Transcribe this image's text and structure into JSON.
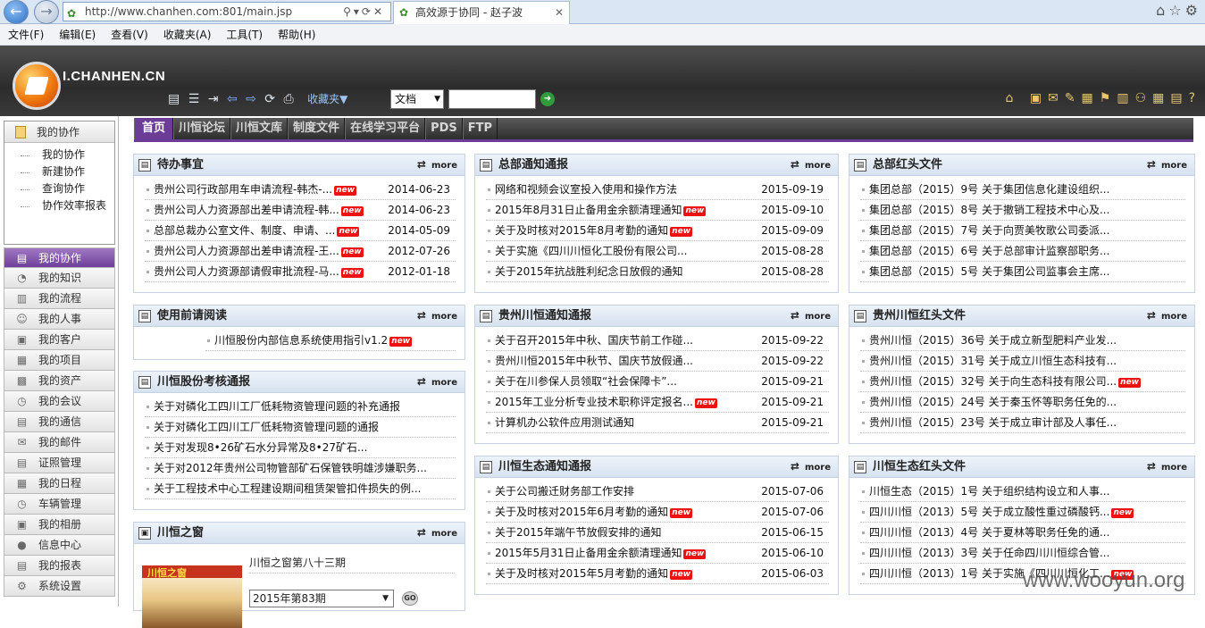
{
  "browser": {
    "url": "http://www.chanhen.com:801/main.jsp",
    "tab_title": "高效源于协同 - 赵子波"
  },
  "menubar": [
    "文件(F)",
    "编辑(E)",
    "查看(V)",
    "收藏夹(A)",
    "工具(T)",
    "帮助(H)"
  ],
  "header": {
    "brand": "I.CHANHEN.CN",
    "favorites_label": "收藏夹▼",
    "doc_type": "文档"
  },
  "sidebar": {
    "box_title": "我的协作",
    "box_items": [
      "我的协作",
      "新建协作",
      "查询协作",
      "协作效率报表"
    ],
    "menu": [
      {
        "label": "我的协作",
        "icon": "collab-icon",
        "active": true
      },
      {
        "label": "我的知识",
        "icon": "knowledge-icon"
      },
      {
        "label": "我的流程",
        "icon": "flow-icon"
      },
      {
        "label": "我的人事",
        "icon": "person-icon"
      },
      {
        "label": "我的客户",
        "icon": "customer-icon"
      },
      {
        "label": "我的项目",
        "icon": "project-icon"
      },
      {
        "label": "我的资产",
        "icon": "asset-icon"
      },
      {
        "label": "我的会议",
        "icon": "meeting-icon"
      },
      {
        "label": "我的通信",
        "icon": "comm-icon"
      },
      {
        "label": "我的邮件",
        "icon": "mail-icon"
      },
      {
        "label": "证照管理",
        "icon": "license-icon"
      },
      {
        "label": "我的日程",
        "icon": "calendar-icon"
      },
      {
        "label": "车辆管理",
        "icon": "car-icon"
      },
      {
        "label": "我的相册",
        "icon": "album-icon"
      },
      {
        "label": "信息中心",
        "icon": "info-icon"
      },
      {
        "label": "我的报表",
        "icon": "report-icon"
      },
      {
        "label": "系统设置",
        "icon": "settings-icon"
      }
    ]
  },
  "tabs": [
    "首页",
    "川恒论坛",
    "川恒文库",
    "制度文件",
    "在线学习平台",
    "PDS",
    "FTP"
  ],
  "more_label": "more",
  "new_label": "new",
  "panels": {
    "todo": {
      "title": "待办事宜",
      "rows": [
        {
          "text": "贵州公司行政部用车申请流程-韩杰-...",
          "new": true,
          "date": "2014-06-23"
        },
        {
          "text": "贵州公司人力资源部出差申请流程-韩...",
          "new": true,
          "date": "2014-06-23"
        },
        {
          "text": "总部总裁办公室文件、制度、申请、...",
          "new": true,
          "date": "2014-05-09"
        },
        {
          "text": "贵州公司人力资源部出差申请流程-王...",
          "new": true,
          "date": "2012-07-26"
        },
        {
          "text": "贵州公司人力资源部请假审批流程-马...",
          "new": true,
          "date": "2012-01-18"
        }
      ]
    },
    "read_before": {
      "title": "使用前请阅读",
      "rows": [
        {
          "text": "川恒股份内部信息系统使用指引v1.2",
          "new": true
        }
      ]
    },
    "audit": {
      "title": "川恒股份考核通报",
      "rows": [
        {
          "text": "关于对磷化工四川工厂低耗物资管理问题的补充通报"
        },
        {
          "text": "关于对磷化工四川工厂低耗物资管理问题的通报"
        },
        {
          "text": "关于对发现8•26矿石水分异常及8•27矿石..."
        },
        {
          "text": "关于对2012年贵州公司物管部矿石保管铁明雄涉嫌职务..."
        },
        {
          "text": "关于工程技术中心工程建设期间租赁架管扣件损失的例..."
        }
      ]
    },
    "window": {
      "title": "川恒之窗",
      "magazine_label": "川恒之窗",
      "item": "川恒之窗第八十三期",
      "issue": "2015年第83期",
      "go": "GO"
    },
    "hq_notice": {
      "title": "总部通知通报",
      "rows": [
        {
          "text": "网络和视频会议室投入使用和操作方法",
          "date": "2015-09-19"
        },
        {
          "text": "2015年8月31日止备用金余额清理通知",
          "new": true,
          "date": "2015-09-10"
        },
        {
          "text": "关于及时核对2015年8月考勤的通知",
          "new": true,
          "date": "2015-09-09"
        },
        {
          "text": "关于实施《四川川恒化工股份有限公司...",
          "date": "2015-08-28"
        },
        {
          "text": "关于2015年抗战胜利纪念日放假的通知",
          "date": "2015-08-28"
        }
      ]
    },
    "gz_notice": {
      "title": "贵州川恒通知通报",
      "rows": [
        {
          "text": "关于召开2015年中秋、国庆节前工作碰...",
          "date": "2015-09-22"
        },
        {
          "text": "贵州川恒2015年中秋节、国庆节放假通...",
          "date": "2015-09-22"
        },
        {
          "text": "关于在川参保人员领取“社会保障卡”...",
          "date": "2015-09-21"
        },
        {
          "text": "2015年工业分析专业技术职称评定报名...",
          "new": true,
          "date": "2015-09-21"
        },
        {
          "text": "计算机办公软件应用测试通知",
          "date": "2015-09-21"
        }
      ]
    },
    "eco_notice": {
      "title": "川恒生态通知通报",
      "rows": [
        {
          "text": "关于公司搬迁财务部工作安排",
          "date": "2015-07-06"
        },
        {
          "text": "关于及时核对2015年6月考勤的通知",
          "new": true,
          "date": "2015-07-06"
        },
        {
          "text": "关于2015年端午节放假安排的通知",
          "date": "2015-06-15"
        },
        {
          "text": "2015年5月31日止备用金余额清理通知",
          "new": true,
          "date": "2015-06-10"
        },
        {
          "text": "关于及时核对2015年5月考勤的通知",
          "new": true,
          "date": "2015-06-03"
        }
      ]
    },
    "hq_red": {
      "title": "总部红头文件",
      "rows": [
        {
          "text": "集团总部（2015）9号 关于集团信息化建设组织..."
        },
        {
          "text": "集团总部（2015）8号 关于撤销工程技术中心及..."
        },
        {
          "text": "集团总部（2015）7号 关于向贾美牧歌公司委派..."
        },
        {
          "text": "集团总部（2015）6号 关于总部审计监察部职务..."
        },
        {
          "text": "集团总部（2015）5号 关于集团公司监事会主席..."
        }
      ]
    },
    "gz_red": {
      "title": "贵州川恒红头文件",
      "rows": [
        {
          "text": "贵州川恒（2015）36号 关于成立新型肥料产业发..."
        },
        {
          "text": "贵州川恒（2015）31号 关于成立川恒生态科技有..."
        },
        {
          "text": "贵州川恒（2015）32号 关于向生态科技有限公司...",
          "new": true
        },
        {
          "text": "贵州川恒（2015）24号 关于秦玉怀等职务任免的..."
        },
        {
          "text": "贵州川恒（2015）23号 关于成立审计部及人事任..."
        }
      ]
    },
    "eco_red": {
      "title": "川恒生态红头文件",
      "rows": [
        {
          "text": "川恒生态（2015）1号 关于组织结构设立和人事..."
        },
        {
          "text": "四川川恒（2013）5号 关于成立酸性重过磷酸钙...",
          "new": true
        },
        {
          "text": "四川川恒（2013）4号 关于夏林等职务任免的通..."
        },
        {
          "text": "四川川恒（2013）3号 关于任命四川川恒综合管..."
        },
        {
          "text": "四川川恒（2013）1号 关于实施《四川川恒化工...",
          "new": true
        }
      ]
    }
  },
  "watermark": "www.wooyun.org"
}
